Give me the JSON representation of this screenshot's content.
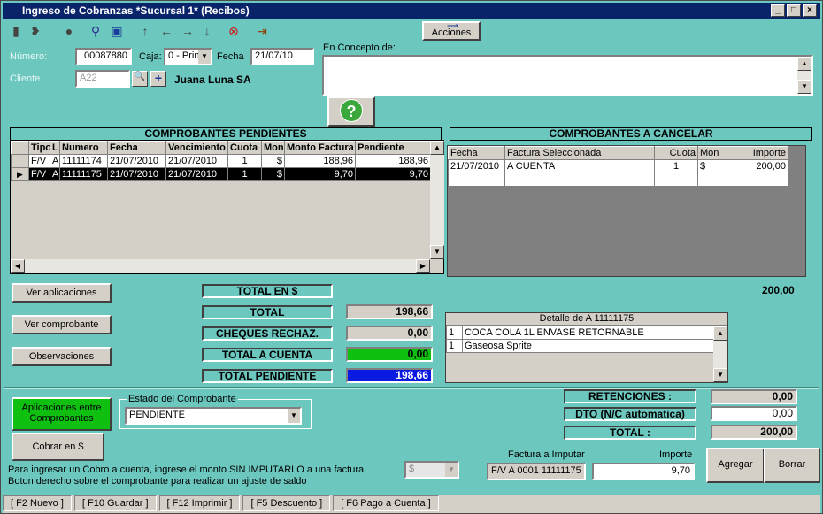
{
  "window": {
    "title": "Ingreso de Cobranzas *Sucursal 1* (Recibos)"
  },
  "toolbar": {
    "acciones_label": "Acciones"
  },
  "form": {
    "numero_label": "Número:",
    "numero_value": "00087880",
    "caja_label": "Caja:",
    "caja_value": "0 - Prin",
    "fecha_label": "Fecha",
    "fecha_value": "21/07/10",
    "cliente_label": "Cliente",
    "cliente_code": "A22",
    "cliente_name": "Juana Luna SA",
    "concepto_label": "En Concepto de:",
    "concepto_value": ""
  },
  "pendientes": {
    "title": "COMPROBANTES PENDIENTES",
    "headers": [
      "Tipo",
      "L",
      "Numero",
      "Fecha",
      "Vencimiento",
      "Cuota",
      "Mon",
      "Monto Factura",
      "Pendiente"
    ],
    "rows": [
      [
        "F/V",
        "A",
        "11111174",
        "21/07/2010",
        "21/07/2010",
        "1",
        "$",
        "188,96",
        "188,96"
      ],
      [
        "F/V",
        "A",
        "11111175",
        "21/07/2010",
        "21/07/2010",
        "1",
        "$",
        "9,70",
        "9,70"
      ]
    ]
  },
  "cancelar": {
    "title": "COMPROBANTES A CANCELAR",
    "headers": [
      "Fecha",
      "Factura Seleccionada",
      "Cuota",
      "Mon",
      "Importe"
    ],
    "rows": [
      [
        "21/07/2010",
        "A CUENTA",
        "1",
        "$",
        "200,00"
      ]
    ],
    "total": "200,00"
  },
  "buttons": {
    "ver_aplicaciones": "Ver aplicaciones",
    "ver_comprobante": "Ver comprobante",
    "observaciones": "Observaciones",
    "aplicaciones_entre": "Aplicaciones entre Comprobantes",
    "cobrar": "Cobrar en $",
    "agregar": "Agregar",
    "borrar": "Borrar"
  },
  "totals": {
    "total_en": "TOTAL EN $",
    "total_label": "TOTAL",
    "total_value": "198,66",
    "cheques_label": "CHEQUES RECHAZ.",
    "cheques_value": "0,00",
    "a_cuenta_label": "TOTAL A CUENTA",
    "a_cuenta_value": "0,00",
    "pendiente_label": "TOTAL PENDIENTE",
    "pendiente_value": "198,66"
  },
  "detalle": {
    "title": "Detalle de A 11111175",
    "items": [
      [
        "1",
        "COCA COLA 1L ENVASE RETORNABLE"
      ],
      [
        "1",
        "Gaseosa Sprite"
      ]
    ]
  },
  "estado": {
    "label": "Estado del Comprobante",
    "value": "PENDIENTE"
  },
  "right_totals": {
    "retenciones_label": "RETENCIONES :",
    "retenciones_value": "0,00",
    "dto_label": "DTO (N/C automatica)",
    "dto_value": "0,00",
    "total_label": "TOTAL :",
    "total_value": "200,00"
  },
  "imputar": {
    "factura_label": "Factura a Imputar",
    "factura_value": "F/V A 0001 11111175",
    "importe_label": "Importe",
    "importe_value": "9,70"
  },
  "hints": {
    "line1": "Para ingresar un Cobro a cuenta, ingrese el monto SIN IMPUTARLO a una factura.",
    "line2": "Boton derecho sobre el comprobante para realizar un ajuste de saldo",
    "currency": "$"
  },
  "statusbar": [
    "[ F2 Nuevo ]",
    "[ F10 Guardar ]",
    "[ F12 Imprimir ]",
    "[ F5 Descuento ]",
    "[ F6 Pago a Cuenta ]"
  ]
}
